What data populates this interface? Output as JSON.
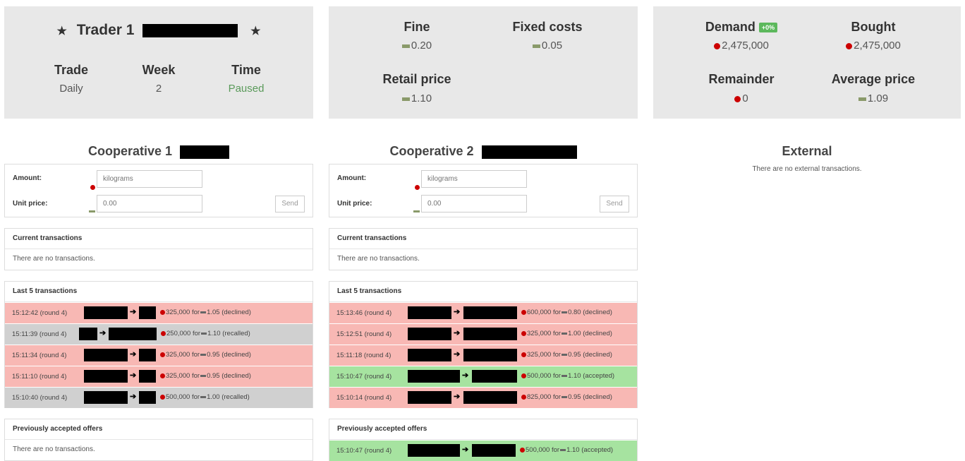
{
  "trader": {
    "title": "Trader 1",
    "star": "★",
    "stats": [
      {
        "label": "Trade",
        "value": "Daily"
      },
      {
        "label": "Week",
        "value": "2"
      },
      {
        "label": "Time",
        "value": "Paused"
      }
    ]
  },
  "costs": {
    "fine": {
      "label": "Fine",
      "value": "0.20"
    },
    "fixed": {
      "label": "Fixed costs",
      "value": "0.05"
    },
    "retail": {
      "label": "Retail price",
      "value": "1.10"
    }
  },
  "market": {
    "demand": {
      "label": "Demand",
      "badge": "+0%",
      "value": "2,475,000"
    },
    "bought": {
      "label": "Bought",
      "value": "2,475,000"
    },
    "remainder": {
      "label": "Remainder",
      "value": "0"
    },
    "average": {
      "label": "Average price",
      "value": "1.09"
    }
  },
  "coop1": {
    "title": "Cooperative 1",
    "form": {
      "amount_label": "Amount:",
      "amount_placeholder": "kilograms",
      "price_label": "Unit price:",
      "price_placeholder": "0.00",
      "send": "Send"
    },
    "current": {
      "title": "Current transactions",
      "empty": "There are no transactions."
    },
    "last": {
      "title": "Last 5 transactions"
    },
    "rows": [
      {
        "time": "15:12:42 (round 4)",
        "desc": "325,000 for",
        "price": "1.05 (declined)",
        "status": "declined"
      },
      {
        "time": "15:11:39 (round 4)",
        "desc": "250,000 for",
        "price": "1.10 (recalled)",
        "status": "recalled"
      },
      {
        "time": "15:11:34 (round 4)",
        "desc": "325,000 for",
        "price": "0.95 (declined)",
        "status": "declined"
      },
      {
        "time": "15:11:10 (round 4)",
        "desc": "325,000 for",
        "price": "0.95 (declined)",
        "status": "declined"
      },
      {
        "time": "15:10:40 (round 4)",
        "desc": "500,000 for",
        "price": "1.00 (recalled)",
        "status": "recalled"
      }
    ],
    "previous": {
      "title": "Previously accepted offers",
      "empty": "There are no transactions."
    }
  },
  "coop2": {
    "title": "Cooperative 2",
    "form": {
      "amount_label": "Amount:",
      "amount_placeholder": "kilograms",
      "price_label": "Unit price:",
      "price_placeholder": "0.00",
      "send": "Send"
    },
    "current": {
      "title": "Current transactions",
      "empty": "There are no transactions."
    },
    "last": {
      "title": "Last 5 transactions"
    },
    "rows": [
      {
        "time": "15:13:46 (round 4)",
        "desc": "600,000 for",
        "price": "0.80 (declined)",
        "status": "declined"
      },
      {
        "time": "15:12:51 (round 4)",
        "desc": "325,000 for",
        "price": "1.00 (declined)",
        "status": "declined"
      },
      {
        "time": "15:11:18 (round 4)",
        "desc": "325,000 for",
        "price": "0.95 (declined)",
        "status": "declined"
      },
      {
        "time": "15:10:47 (round 4)",
        "desc": "500,000 for",
        "price": "1.10 (accepted)",
        "status": "accepted"
      },
      {
        "time": "15:10:14 (round 4)",
        "desc": "825,000 for",
        "price": "0.95 (declined)",
        "status": "declined"
      }
    ],
    "previous": {
      "title": "Previously accepted offers"
    },
    "previous_rows": [
      {
        "time": "15:10:47 (round 4)",
        "desc": "500,000 for",
        "price": "1.10 (accepted)",
        "status": "accepted"
      }
    ]
  },
  "external": {
    "title": "External",
    "empty": "There are no external transactions."
  }
}
